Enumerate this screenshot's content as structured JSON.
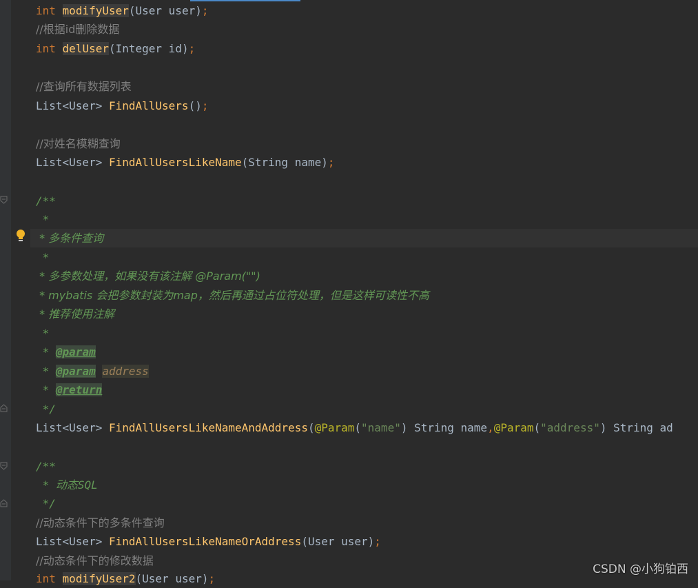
{
  "editor": {
    "lines": {
      "l1": {
        "kw": "int",
        "fn": "modifyUser",
        "rest": "(User user)",
        "semi": ";"
      },
      "l2": {
        "comment": "//根据id删除数据"
      },
      "l3": {
        "kw": "int",
        "fn": "delUser",
        "rest": "(Integer id)",
        "semi": ";"
      },
      "l4": {
        "comment": "//查询所有数据列表"
      },
      "l5": {
        "type": "List<User>",
        "fn": "FindAllUsers",
        "rest": "()",
        "semi": ";"
      },
      "l6": {
        "comment": "//对姓名模糊查询"
      },
      "l7": {
        "type": "List<User>",
        "fn": "FindAllUsersLikeName",
        "rest": "(String name)",
        "semi": ";"
      },
      "l8": {
        "doc": "/**"
      },
      "l9": {
        "doc": " *"
      },
      "l10": {
        "doc": " * 多条件查询"
      },
      "l11": {
        "doc": " *"
      },
      "l12": {
        "doc": " * 多参数处理，如果没有该注解 @Param(\"\")"
      },
      "l13": {
        "doc": " * mybatis 会把参数封装为map，然后再通过占位符处理，但是这样可读性不高"
      },
      "l14": {
        "doc": " * 推荐使用注解"
      },
      "l15": {
        "doc": " *"
      },
      "l16": {
        "doc": " * ",
        "tag": "@param"
      },
      "l17": {
        "doc": " * ",
        "tag": "@param",
        "param": "address"
      },
      "l18": {
        "doc": " * ",
        "tag": "@return"
      },
      "l19": {
        "doc": " */"
      },
      "l20": {
        "type": "List<User>",
        "fn": "FindAllUsersLikeNameAndAddress",
        "p1": "(",
        "a1": "@Param",
        "s1": "(",
        "str1": "\"name\"",
        "s2": ") String name",
        "comma": ",",
        "a2": "@Param",
        "s3": "(",
        "str2": "\"address\"",
        "s4": ") String ad"
      },
      "l21": {
        "doc": "/**"
      },
      "l22": {
        "doc": " * 动态SQL"
      },
      "l23": {
        "doc": " */"
      },
      "l24": {
        "comment": "//动态条件下的多条件查询"
      },
      "l25": {
        "type": "List<User>",
        "fn": "FindAllUsersLikeNameOrAddress",
        "rest": "(User user)",
        "semi": ";"
      },
      "l26": {
        "comment": "//动态条件下的修改数据"
      },
      "l27": {
        "kw": "int",
        "fn": "modifyUser2",
        "rest": "(User user)",
        "semi": ";"
      }
    },
    "icons": {
      "fold": "fold-marker-icon",
      "bulb": "lightbulb-icon"
    }
  },
  "watermark": "CSDN @小狗铂西",
  "colors": {
    "background": "#2b2b2b",
    "keyword": "#cc7832",
    "function": "#ffc66d",
    "comment": "#808080",
    "doc": "#629755",
    "string": "#6a8759",
    "annotation": "#bbb529"
  }
}
